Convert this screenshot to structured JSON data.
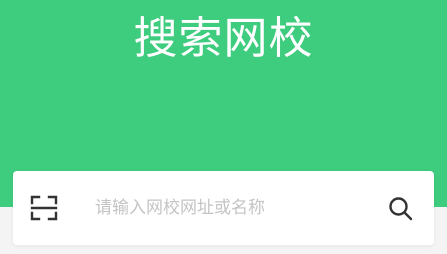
{
  "header": {
    "title": "搜索网校",
    "background_color": "#3ecc7e"
  },
  "search": {
    "placeholder": "请输入网校网址或名称",
    "value": "",
    "left_icon": "scan-icon",
    "right_icon": "search-icon"
  }
}
